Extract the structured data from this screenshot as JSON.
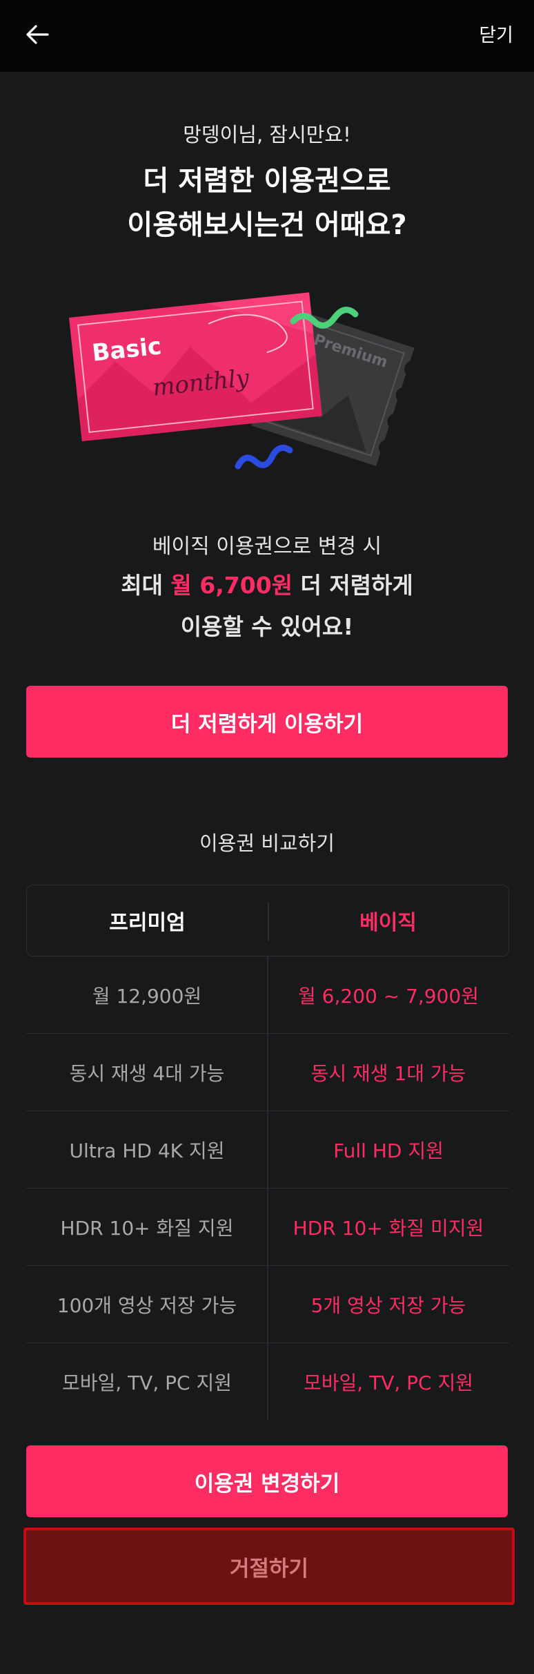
{
  "header": {
    "back_icon": "arrow-left-icon",
    "close_label": "닫기"
  },
  "greeting": "망뎅이님, 잠시만요!",
  "headline": {
    "line1": "더 저렴한 이용권으로",
    "line2": "이용해보시는건 어때요?"
  },
  "illustration": {
    "basic_ticket_title": "Basic",
    "basic_ticket_script": "monthly",
    "premium_ticket_title": "+ Premium",
    "basic_color": "#f03a74",
    "premium_color": "#3a3a3c"
  },
  "promo": {
    "line1": "베이직 이용권으로 변경 시",
    "line2_prefix": "최대 ",
    "line2_accent": "월 6,700원",
    "line2_suffix": " 더 저렴하게",
    "line3": "이용할 수 있어요!"
  },
  "cta_top_label": "더 저렴하게 이용하기",
  "compare": {
    "title": "이용권 비교하기",
    "premium_header": "프리미엄",
    "basic_header": "베이직",
    "rows": [
      {
        "premium": "월 12,900원",
        "basic": "월 6,200 ~ 7,900원"
      },
      {
        "premium": "동시 재생 4대 가능",
        "basic": "동시 재생 1대 가능"
      },
      {
        "premium": "Ultra HD 4K 지원",
        "basic": "Full HD 지원"
      },
      {
        "premium": "HDR 10+ 화질 지원",
        "basic": "HDR 10+ 화질 미지원"
      },
      {
        "premium": "100개 영상 저장 가능",
        "basic": "5개 영상 저장 가능"
      },
      {
        "premium": "모바일, TV, PC 지원",
        "basic": "모바일, TV, PC 지원"
      }
    ]
  },
  "cta_bottom_label": "이용권 변경하기",
  "decline_label": "거절하기",
  "colors": {
    "accent": "#ff2d63",
    "background": "#18191b",
    "decline_bg": "#6e1113",
    "decline_border": "#c20f12"
  }
}
